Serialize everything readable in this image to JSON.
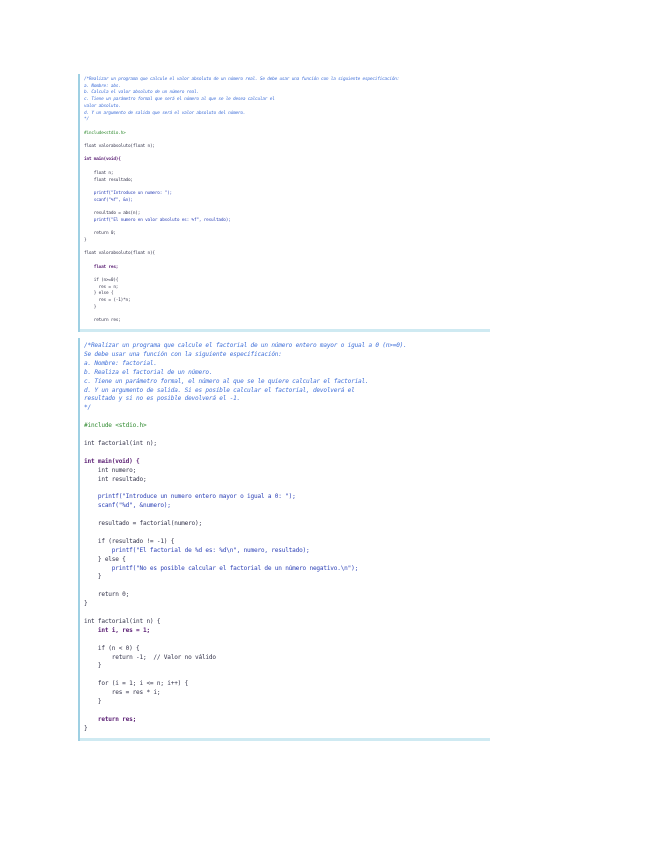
{
  "snippet1": {
    "lines": [
      {
        "text": "/*Realizar un programa que calcule el valor absoluto de un número real. Se debe usar una función con la siguiente especificación:",
        "kind": "comment"
      },
      {
        "text": "a. Nombre: abs.",
        "kind": "comment"
      },
      {
        "text": "b. Calcula el valor absoluto de un número real.",
        "kind": "comment"
      },
      {
        "text": "c. Tiene un parámetro formal que será el número al que se le desea calcular el",
        "kind": "comment"
      },
      {
        "text": "valor absoluto.",
        "kind": "comment"
      },
      {
        "text": "d. Y un argumento de salida que será el valor absoluto del número.",
        "kind": "comment"
      },
      {
        "text": "*/",
        "kind": "comment"
      },
      {
        "text": "",
        "kind": "plain"
      },
      {
        "text": "#include<stdio.h>",
        "kind": "dir"
      },
      {
        "text": "",
        "kind": "plain"
      },
      {
        "text": "float valorabsoluto(float n);",
        "kind": "plain"
      },
      {
        "text": "",
        "kind": "plain"
      },
      {
        "text": "int main(void){",
        "kind": "kw"
      },
      {
        "text": "",
        "kind": "plain"
      },
      {
        "text": "    float n;",
        "kind": "plain"
      },
      {
        "text": "    float resultado;",
        "kind": "plain"
      },
      {
        "text": "",
        "kind": "plain"
      },
      {
        "text": "    printf(\"Introduce un numero: \");",
        "kind": "str"
      },
      {
        "text": "    scanf(\"%f\", &n);",
        "kind": "str"
      },
      {
        "text": "",
        "kind": "plain"
      },
      {
        "text": "    resultado = abs(n);",
        "kind": "plain"
      },
      {
        "text": "    printf(\"El numero en valor absoluto es: %f\", resultado);",
        "kind": "str"
      },
      {
        "text": "",
        "kind": "plain"
      },
      {
        "text": "    return 0;",
        "kind": "plain"
      },
      {
        "text": "}",
        "kind": "plain"
      },
      {
        "text": "",
        "kind": "plain"
      },
      {
        "text": "float valorabsoluto(float n){",
        "kind": "plain"
      },
      {
        "text": "",
        "kind": "plain"
      },
      {
        "text": "    float res;",
        "kind": "kw"
      },
      {
        "text": "",
        "kind": "plain"
      },
      {
        "text": "    if (n>=0){",
        "kind": "plain"
      },
      {
        "text": "      res = n;",
        "kind": "plain"
      },
      {
        "text": "    } else {",
        "kind": "plain"
      },
      {
        "text": "      res = (-1)*n;",
        "kind": "plain"
      },
      {
        "text": "    }",
        "kind": "plain"
      },
      {
        "text": "",
        "kind": "plain"
      },
      {
        "text": "    return res;",
        "kind": "plain"
      }
    ]
  },
  "snippet2": {
    "lines": [
      {
        "text": "/*Realizar un programa que calcule el factorial de un número entero mayor o igual a 0 (n>=0).",
        "kind": "comment"
      },
      {
        "text": "Se debe usar una función con la siguiente especificación:",
        "kind": "comment"
      },
      {
        "text": "a. Nombre: factorial.",
        "kind": "comment"
      },
      {
        "text": "b. Realiza el factorial de un número.",
        "kind": "comment"
      },
      {
        "text": "c. Tiene un parámetro formal, el número al que se le quiere calcular el factorial.",
        "kind": "comment"
      },
      {
        "text": "d. Y un argumento de salida. Si es posible calcular el factorial, devolverá el",
        "kind": "comment"
      },
      {
        "text": "resultado y si no es posible devolverá el -1.",
        "kind": "comment"
      },
      {
        "text": "*/",
        "kind": "comment"
      },
      {
        "text": "",
        "kind": "plain"
      },
      {
        "text": "#include <stdio.h>",
        "kind": "dir"
      },
      {
        "text": "",
        "kind": "plain"
      },
      {
        "text": "int factorial(int n);",
        "kind": "plain"
      },
      {
        "text": "",
        "kind": "plain"
      },
      {
        "text": "int main(void) {",
        "kind": "kw"
      },
      {
        "text": "    int numero;",
        "kind": "plain"
      },
      {
        "text": "    int resultado;",
        "kind": "plain"
      },
      {
        "text": "",
        "kind": "plain"
      },
      {
        "text": "    printf(\"Introduce un numero entero mayor o igual a 0: \");",
        "kind": "str"
      },
      {
        "text": "    scanf(\"%d\", &numero);",
        "kind": "str"
      },
      {
        "text": "",
        "kind": "plain"
      },
      {
        "text": "    resultado = factorial(numero);",
        "kind": "plain"
      },
      {
        "text": "",
        "kind": "plain"
      },
      {
        "text": "    if (resultado != -1) {",
        "kind": "plain"
      },
      {
        "text": "        printf(\"El factorial de %d es: %d\\n\", numero, resultado);",
        "kind": "str"
      },
      {
        "text": "    } else {",
        "kind": "plain"
      },
      {
        "text": "        printf(\"No es posible calcular el factorial de un número negativo.\\n\");",
        "kind": "str"
      },
      {
        "text": "    }",
        "kind": "plain"
      },
      {
        "text": "",
        "kind": "plain"
      },
      {
        "text": "    return 0;",
        "kind": "plain"
      },
      {
        "text": "}",
        "kind": "plain"
      },
      {
        "text": "",
        "kind": "plain"
      },
      {
        "text": "int factorial(int n) {",
        "kind": "plain"
      },
      {
        "text": "    int i, res = 1;",
        "kind": "kw"
      },
      {
        "text": "",
        "kind": "plain"
      },
      {
        "text": "    if (n < 0) {",
        "kind": "plain"
      },
      {
        "text": "        return -1;  // Valor no válido",
        "kind": "plain"
      },
      {
        "text": "    }",
        "kind": "plain"
      },
      {
        "text": "",
        "kind": "plain"
      },
      {
        "text": "    for (i = 1; i <= n; i++) {",
        "kind": "plain"
      },
      {
        "text": "        res = res * i;",
        "kind": "plain"
      },
      {
        "text": "    }",
        "kind": "plain"
      },
      {
        "text": "",
        "kind": "plain"
      },
      {
        "text": "    return res;",
        "kind": "kw"
      },
      {
        "text": "}",
        "kind": "plain"
      }
    ]
  }
}
